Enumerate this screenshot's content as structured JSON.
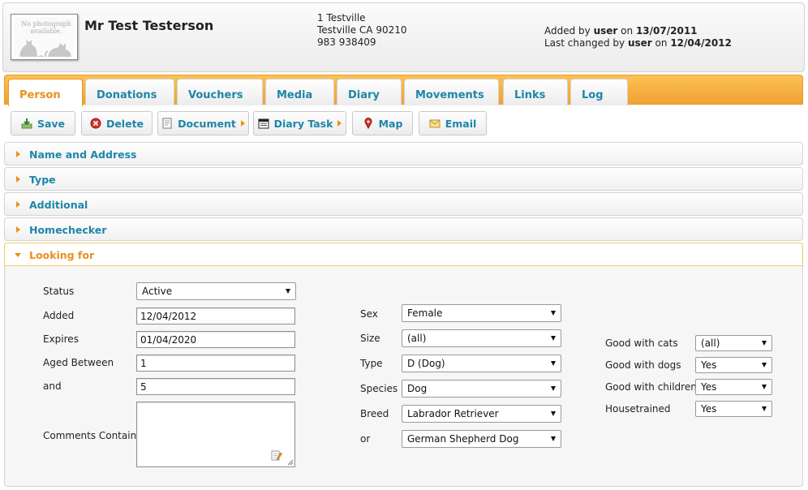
{
  "photo": {
    "placeholder_text": "No photograph available."
  },
  "person": {
    "name": "Mr Test Testerson",
    "address_line1": "1 Testville",
    "address_line2": "Testville CA 90210",
    "phone": "983 938409"
  },
  "audit": {
    "added_prefix": "Added by",
    "added_user": "user",
    "added_on": "on",
    "added_date": "13/07/2011",
    "changed_prefix": "Last changed by",
    "changed_user": "user",
    "changed_on": "on",
    "changed_date": "12/04/2012"
  },
  "tabs": [
    {
      "label": "Person",
      "active": true
    },
    {
      "label": "Donations"
    },
    {
      "label": "Vouchers"
    },
    {
      "label": "Media"
    },
    {
      "label": "Diary"
    },
    {
      "label": "Movements"
    },
    {
      "label": "Links"
    },
    {
      "label": "Log"
    }
  ],
  "toolbar": {
    "save": "Save",
    "delete": "Delete",
    "document": "Document",
    "diary_task": "Diary Task",
    "map": "Map",
    "email": "Email"
  },
  "sections": [
    {
      "label": "Name and Address"
    },
    {
      "label": "Type"
    },
    {
      "label": "Additional"
    },
    {
      "label": "Homechecker"
    },
    {
      "label": "Looking for",
      "open": true
    }
  ],
  "looking_for": {
    "status": {
      "label": "Status",
      "value": "Active"
    },
    "added": {
      "label": "Added",
      "value": "12/04/2012"
    },
    "expires": {
      "label": "Expires",
      "value": "01/04/2020"
    },
    "aged_between": {
      "label": "Aged Between",
      "value": "1"
    },
    "and": {
      "label": "and",
      "value": "5"
    },
    "comments": {
      "label": "Comments Contain",
      "value": ""
    },
    "sex": {
      "label": "Sex",
      "value": "Female"
    },
    "size": {
      "label": "Size",
      "value": "(all)"
    },
    "type": {
      "label": "Type",
      "value": "D (Dog)"
    },
    "species": {
      "label": "Species",
      "value": "Dog"
    },
    "breed": {
      "label": "Breed",
      "value": "Labrador Retriever"
    },
    "breed_or": {
      "label": "or",
      "value": "German Shepherd Dog"
    },
    "good_cats": {
      "label": "Good with cats",
      "value": "(all)"
    },
    "good_dogs": {
      "label": "Good with dogs",
      "value": "Yes"
    },
    "good_children": {
      "label": "Good with children",
      "value": "Yes"
    },
    "housetrained": {
      "label": "Housetrained",
      "value": "Yes"
    }
  },
  "colors": {
    "accent": "#f0a131",
    "link": "#1d86a8",
    "active_text": "#e8901c"
  }
}
